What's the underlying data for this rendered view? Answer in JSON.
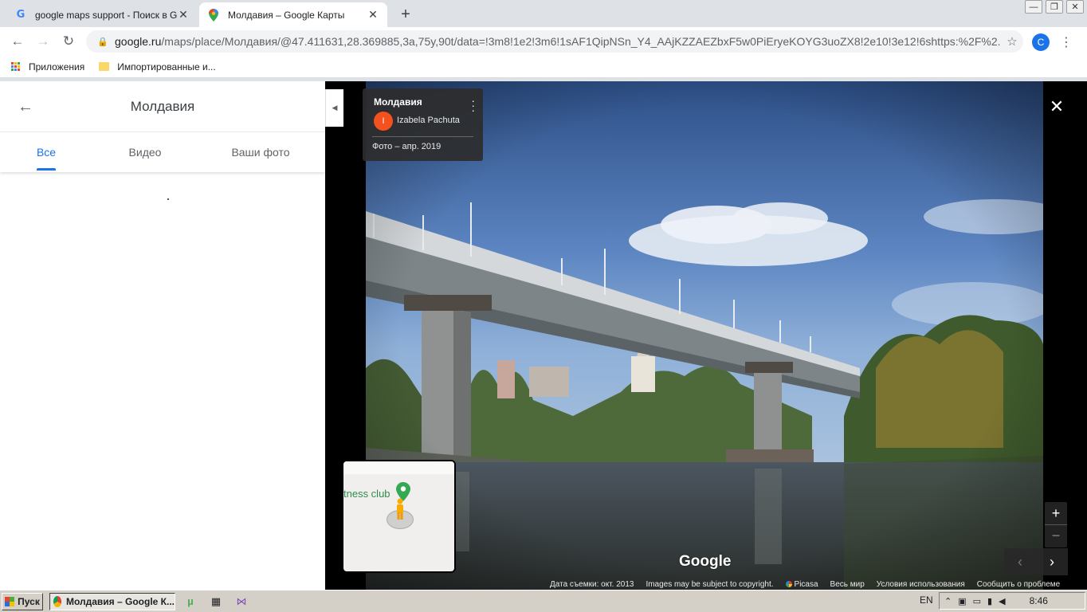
{
  "browser": {
    "tabs": [
      {
        "title": "google maps support - Поиск в Goo",
        "favicon": "google-g-icon",
        "active": false
      },
      {
        "title": "Молдавия – Google Карты",
        "favicon": "maps-pin-icon",
        "active": true
      }
    ],
    "url_host": "google.ru",
    "url_path": "/maps/place/Молдавия/@47.411631,28.369885,3a,75y,90t/data=!3m8!1e2!3m6!1sAF1QipNSn_Y4_AAjKZZAEZbxF5w0PiEryeKOYG3uoZX8!2e10!3e12!6shttps:%2F%2...",
    "profile_initial": "C",
    "bookmarks": [
      {
        "label": "Приложения",
        "icon": "apps-grid-icon"
      },
      {
        "label": "Импортированные и...",
        "icon": "folder-icon"
      }
    ]
  },
  "sidepanel": {
    "title": "Молдавия",
    "tabs": [
      "Все",
      "Видео",
      "Ваши фото"
    ],
    "active_tab": 0
  },
  "photo": {
    "place": "Молдавия",
    "author": "Izabela Pachuta",
    "author_initial": "I",
    "date": "Фото – апр. 2019",
    "logo": "Google",
    "minimap_label": "tness club"
  },
  "footer": {
    "capture_date": "Дата съемки: окт. 2013",
    "copyright": "Images may be subject to copyright.",
    "source": "Picasa",
    "world": "Весь мир",
    "terms": "Условия использования",
    "report": "Сообщить о проблеме"
  },
  "taskbar": {
    "start": "Пуск",
    "task": "Молдавия – Google К...",
    "lang": "EN",
    "clock": "8:46"
  },
  "colors": {
    "accent_blue": "#1a73e8",
    "avatar_orange": "#f4511e",
    "minimap_green": "#2f8d4c"
  }
}
